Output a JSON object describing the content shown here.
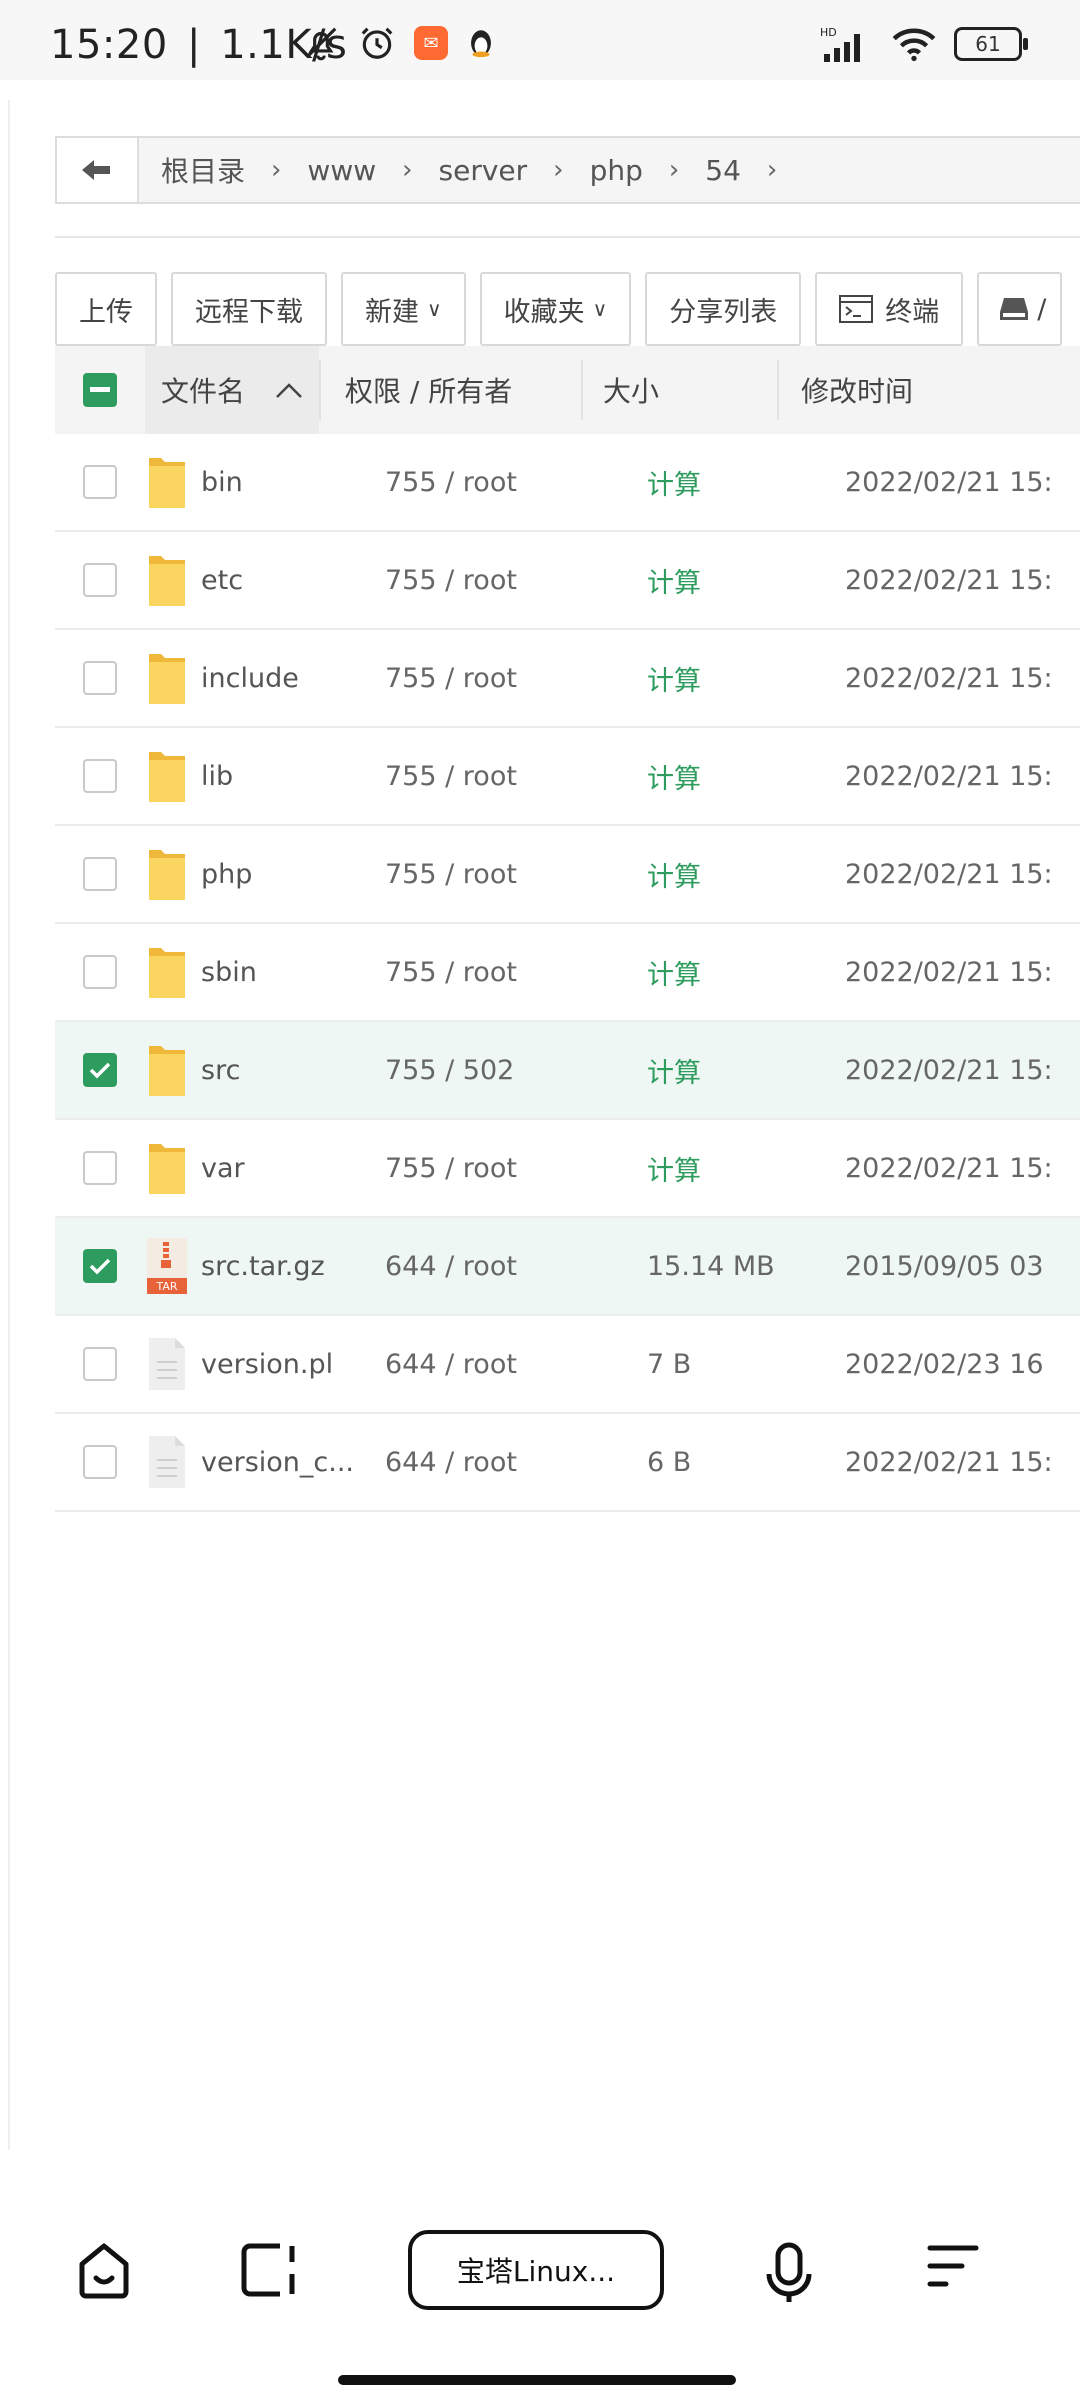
{
  "status_bar": {
    "time": "15:20",
    "speed": "1.1K/s",
    "network": "HD",
    "battery": "61",
    "icons": [
      "bell-off-icon",
      "alarm-icon",
      "app-badge-icon",
      "qq-penguin-icon",
      "signal-icon",
      "wifi-icon",
      "battery-icon"
    ]
  },
  "breadcrumb": {
    "items": [
      "根目录",
      "www",
      "server",
      "php",
      "54"
    ]
  },
  "toolbar": {
    "upload": "上传",
    "remote_download": "远程下载",
    "new": "新建",
    "favorites": "收藏夹",
    "share_list": "分享列表",
    "terminal": "终端"
  },
  "table": {
    "headers": {
      "name": "文件名",
      "perm_owner": "权限 / 所有者",
      "size": "大小",
      "modified": "修改时间"
    },
    "rows": [
      {
        "name": "bin",
        "type": "folder",
        "perm": "755 / root",
        "size": "计算",
        "time": "2022/02/21 15:",
        "checked": false
      },
      {
        "name": "etc",
        "type": "folder",
        "perm": "755 / root",
        "size": "计算",
        "time": "2022/02/21 15:",
        "checked": false
      },
      {
        "name": "include",
        "type": "folder",
        "perm": "755 / root",
        "size": "计算",
        "time": "2022/02/21 15:",
        "checked": false
      },
      {
        "name": "lib",
        "type": "folder",
        "perm": "755 / root",
        "size": "计算",
        "time": "2022/02/21 15:",
        "checked": false
      },
      {
        "name": "php",
        "type": "folder",
        "perm": "755 / root",
        "size": "计算",
        "time": "2022/02/21 15:",
        "checked": false
      },
      {
        "name": "sbin",
        "type": "folder",
        "perm": "755 / root",
        "size": "计算",
        "time": "2022/02/21 15:",
        "checked": false
      },
      {
        "name": "src",
        "type": "folder",
        "perm": "755 / 502",
        "size": "计算",
        "time": "2022/02/21 15:",
        "checked": true
      },
      {
        "name": "var",
        "type": "folder",
        "perm": "755 / root",
        "size": "计算",
        "time": "2022/02/21 15:",
        "checked": false
      },
      {
        "name": "src.tar.gz",
        "type": "tar",
        "perm": "644 / root",
        "size": "15.14 MB",
        "time": "2015/09/05 03",
        "checked": true
      },
      {
        "name": "version.pl",
        "type": "file",
        "perm": "644 / root",
        "size": "7 B",
        "time": "2022/02/23 16",
        "checked": false
      },
      {
        "name": "version_c...",
        "type": "file",
        "perm": "644 / root",
        "size": "6 B",
        "time": "2022/02/21 15:",
        "checked": false
      }
    ]
  },
  "bottom_nav": {
    "app_label": "宝塔Linux..."
  },
  "colors": {
    "accent_green": "#2e9c5e",
    "folder_yellow": "#f6c94a",
    "tar_orange": "#e8633a"
  }
}
